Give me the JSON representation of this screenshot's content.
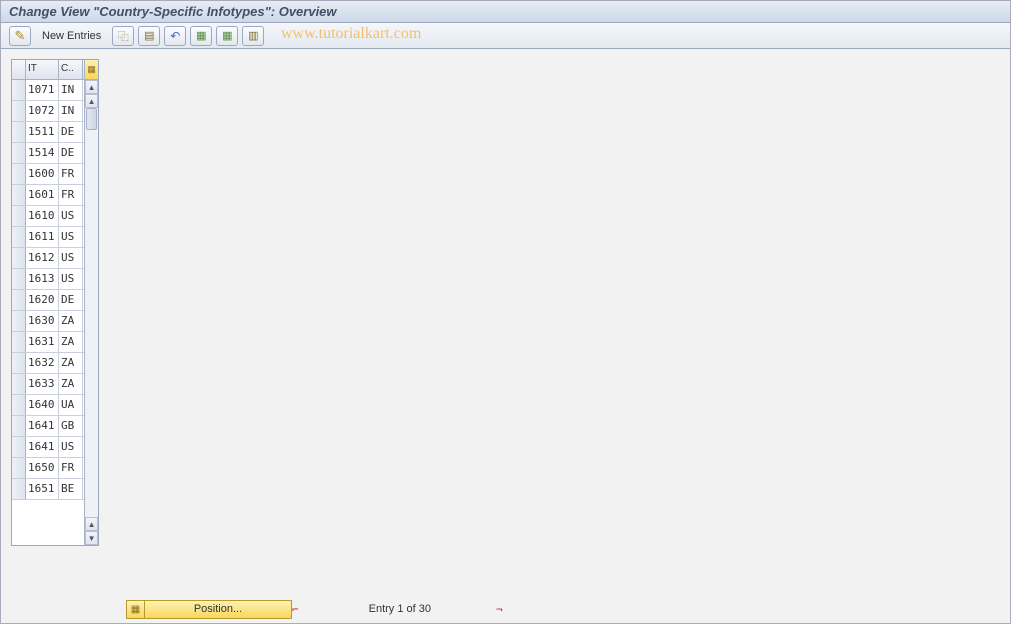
{
  "title": "Change View \"Country-Specific Infotypes\": Overview",
  "watermark": "www.tutorialkart.com",
  "toolbar": {
    "new_entries_label": "New Entries"
  },
  "grid": {
    "columns": {
      "sel": "",
      "it": "IT",
      "c": "C.."
    },
    "rows": [
      {
        "it": "1071",
        "c": "IN"
      },
      {
        "it": "1072",
        "c": "IN"
      },
      {
        "it": "1511",
        "c": "DE"
      },
      {
        "it": "1514",
        "c": "DE"
      },
      {
        "it": "1600",
        "c": "FR"
      },
      {
        "it": "1601",
        "c": "FR"
      },
      {
        "it": "1610",
        "c": "US"
      },
      {
        "it": "1611",
        "c": "US"
      },
      {
        "it": "1612",
        "c": "US"
      },
      {
        "it": "1613",
        "c": "US"
      },
      {
        "it": "1620",
        "c": "DE"
      },
      {
        "it": "1630",
        "c": "ZA"
      },
      {
        "it": "1631",
        "c": "ZA"
      },
      {
        "it": "1632",
        "c": "ZA"
      },
      {
        "it": "1633",
        "c": "ZA"
      },
      {
        "it": "1640",
        "c": "UA"
      },
      {
        "it": "1641",
        "c": "GB"
      },
      {
        "it": "1641",
        "c": "US"
      },
      {
        "it": "1650",
        "c": "FR"
      },
      {
        "it": "1651",
        "c": "BE"
      }
    ]
  },
  "footer": {
    "position_label": "Position...",
    "entry_text": "Entry 1 of 30"
  }
}
